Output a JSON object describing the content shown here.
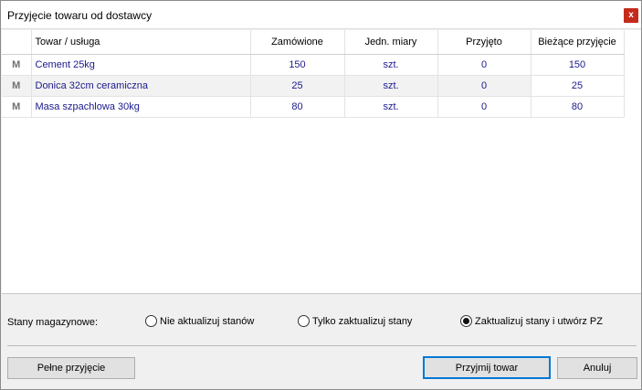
{
  "window": {
    "title": "Przyjęcie towaru od dostawcy",
    "close_label": "x"
  },
  "grid": {
    "headers": {
      "name": "Towar / usługa",
      "ordered": "Zamówione",
      "unit": "Jedn. miary",
      "received": "Przyjęto",
      "current": "Bieżące przyjęcie"
    },
    "rows": [
      {
        "marker": "M",
        "name": "Cement 25kg",
        "ordered": "150",
        "unit": "szt.",
        "received": "0",
        "current": "150"
      },
      {
        "marker": "M",
        "name": "Donica 32cm ceramiczna",
        "ordered": "25",
        "unit": "szt.",
        "received": "0",
        "current": "25"
      },
      {
        "marker": "M",
        "name": "Masa szpachlowa 30kg",
        "ordered": "80",
        "unit": "szt.",
        "received": "0",
        "current": "80"
      }
    ]
  },
  "stock": {
    "label": "Stany magazynowe:",
    "options": [
      {
        "label": "Nie aktualizuj stanów",
        "checked": false
      },
      {
        "label": "Tylko zaktualizuj stany",
        "checked": false
      },
      {
        "label": "Zaktualizuj stany i utwórz PZ",
        "checked": true
      }
    ]
  },
  "buttons": {
    "full_receipt": "Pełne przyjęcie",
    "accept": "Przyjmij towar",
    "cancel": "Anuluj"
  },
  "colors": {
    "value_text": "#1a1a8c",
    "close_button": "#c42b1c",
    "default_button_border": "#0078d7"
  }
}
